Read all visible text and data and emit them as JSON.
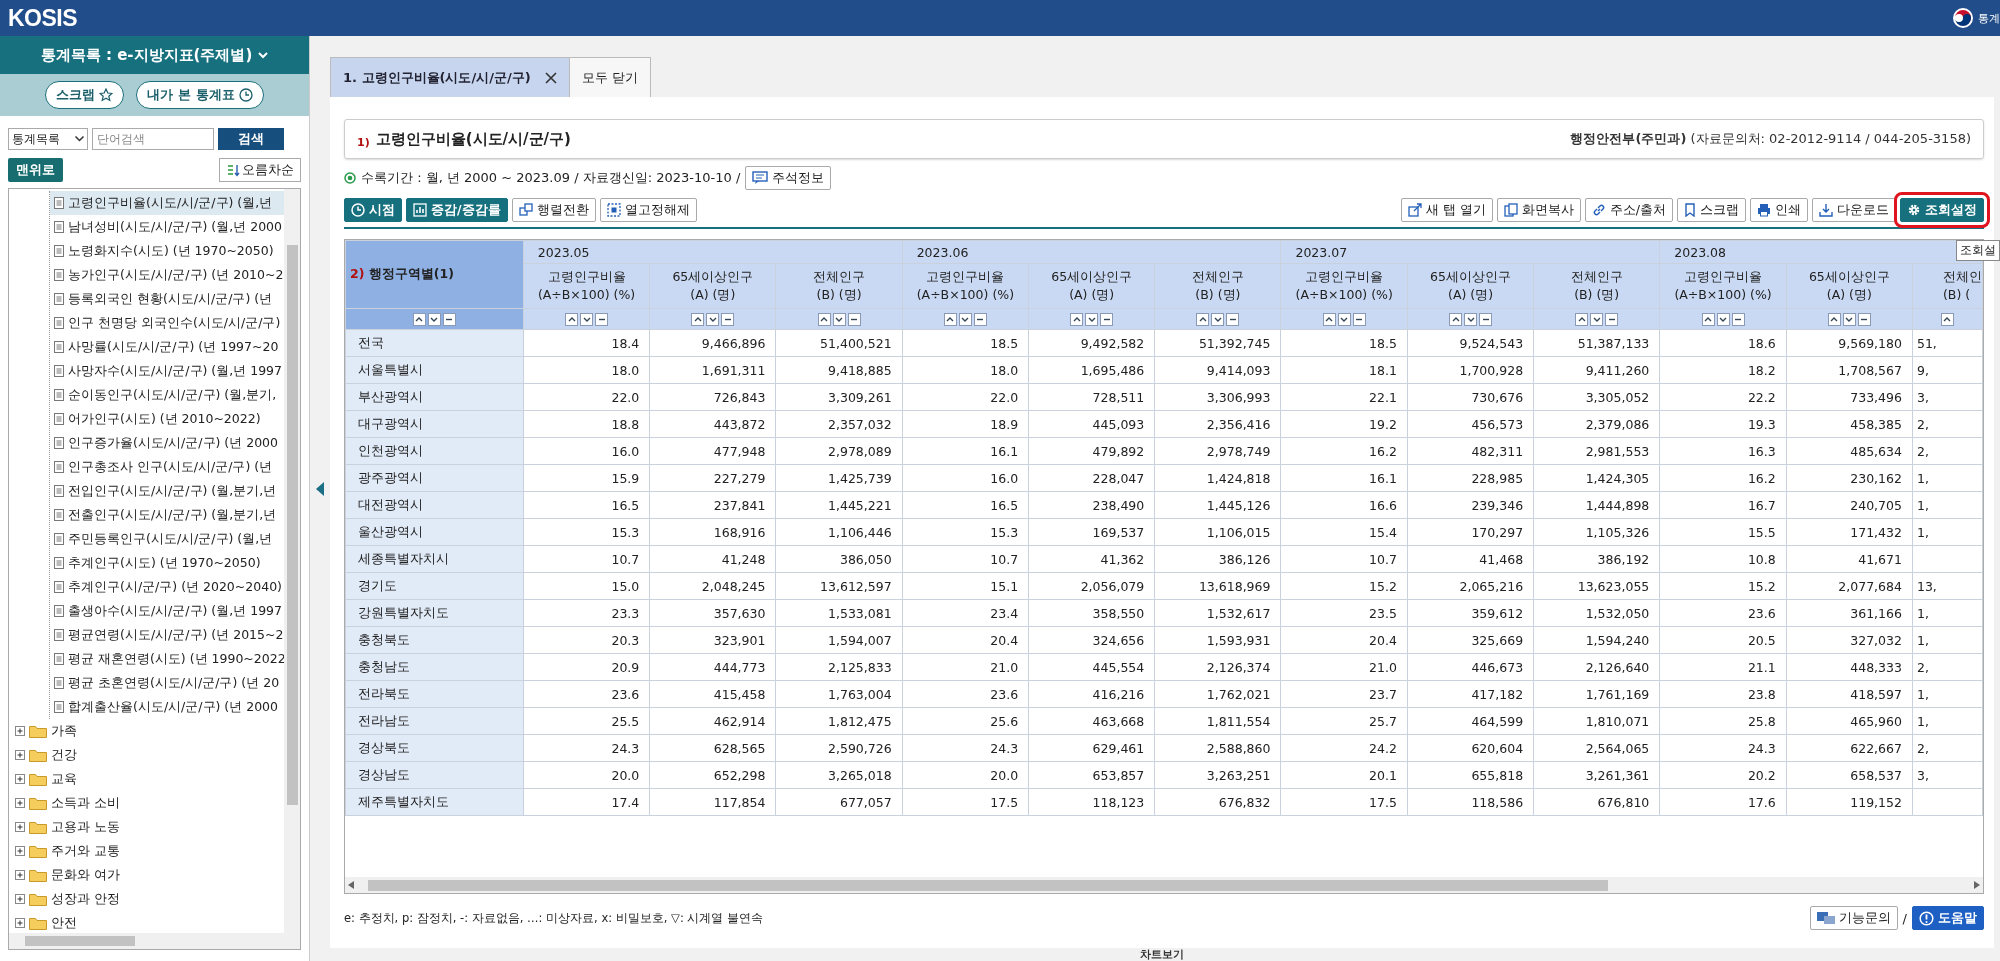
{
  "topbar": {
    "logo": "KOSIS",
    "emblem_text": "통계"
  },
  "sidebar": {
    "title": "통계목록 : e-지방지표(주제별)",
    "buttons": [
      "스크랩",
      "내가 본 통계표"
    ],
    "search": {
      "select": "통계목록",
      "placeholder": "단어검색",
      "button": "검색"
    },
    "top_button": "맨위로",
    "sort_button": "오름차순",
    "tree": [
      {
        "children": [
          {
            "label": "고령인구비율(시도/시/군/구) (월,년",
            "selected": true
          },
          {
            "label": "남녀성비(시도/시/군/구) (월,년 2000",
            "selected": false
          },
          {
            "label": "노령화지수(시도) (년 1970~2050)",
            "selected": false
          },
          {
            "label": "농가인구(시도/시/군/구) (년 2010~2",
            "selected": false
          },
          {
            "label": "등록외국인 현황(시도/시/군/구) (년",
            "selected": false
          },
          {
            "label": "인구 천명당 외국인수(시도/시/군/구)",
            "selected": false
          },
          {
            "label": "사망률(시도/시/군/구) (년 1997~20",
            "selected": false
          },
          {
            "label": "사망자수(시도/시/군/구) (월,년 1997",
            "selected": false
          },
          {
            "label": "순이동인구(시도/시/군/구) (월,분기,",
            "selected": false
          },
          {
            "label": "어가인구(시도) (년 2010~2022)",
            "selected": false
          },
          {
            "label": "인구증가율(시도/시/군/구) (년 2000",
            "selected": false
          },
          {
            "label": "인구총조사 인구(시도/시/군/구) (년",
            "selected": false
          },
          {
            "label": "전입인구(시도/시/군/구) (월,분기,년",
            "selected": false
          },
          {
            "label": "전출인구(시도/시/군/구) (월,분기,년",
            "selected": false
          },
          {
            "label": "주민등록인구(시도/시/군/구) (월,년",
            "selected": false
          },
          {
            "label": "추계인구(시도) (년 1970~2050)",
            "selected": false
          },
          {
            "label": "추계인구(시/군/구) (년 2020~2040)",
            "selected": false
          },
          {
            "label": "출생아수(시도/시/군/구) (월,년 1997",
            "selected": false
          },
          {
            "label": "평균연령(시도/시/군/구) (년 2015~2",
            "selected": false
          },
          {
            "label": "평균 재혼연령(시도) (년 1990~2022",
            "selected": false
          },
          {
            "label": "평균 초혼연령(시도/시/군/구) (년 20",
            "selected": false
          },
          {
            "label": "합계출산율(시도/시/군/구) (년 2000",
            "selected": false
          }
        ]
      },
      {
        "label": "가족",
        "expanded": false
      },
      {
        "label": "건강",
        "expanded": false
      },
      {
        "label": "교육",
        "expanded": false
      },
      {
        "label": "소득과 소비",
        "expanded": false
      },
      {
        "label": "고용과 노동",
        "expanded": false
      },
      {
        "label": "주거와 교통",
        "expanded": false
      },
      {
        "label": "문화와 여가",
        "expanded": false
      },
      {
        "label": "성장과 안정",
        "expanded": false
      },
      {
        "label": "안전",
        "expanded": false
      }
    ]
  },
  "tabs": [
    {
      "label": "1. 고령인구비율(시도/시/군/구)",
      "selected": true
    }
  ],
  "close_all": "모두 닫기",
  "title_box": {
    "note": "1)",
    "title": "고령인구비율(시도/시/군/구)",
    "source": "**행정안전부(주민과)** (자료문의처: 02-2012-9114 / 044-205-3158)"
  },
  "info": {
    "text": "수록기간 : 월, 년 2000 ~ 2023.09 / 자료갱신일: 2023-10-10 /",
    "button": "주석정보"
  },
  "toolbar_left": [
    {
      "label": "시점",
      "kind": "primary"
    },
    {
      "label": "증감/증감률",
      "kind": "primary"
    },
    {
      "label": "행렬전환",
      "kind": "plain"
    },
    {
      "label": "열고정해제",
      "kind": "plain"
    }
  ],
  "toolbar_right": [
    {
      "label": "새 탭 열기",
      "kind": "plain",
      "highlighted": false
    },
    {
      "label": "화면복사",
      "kind": "plain",
      "highlighted": false
    },
    {
      "label": "주소/출처",
      "kind": "plain",
      "highlighted": false
    },
    {
      "label": "스크랩",
      "kind": "plain",
      "highlighted": false
    },
    {
      "label": "인쇄",
      "kind": "plain",
      "highlighted": false
    },
    {
      "label": "다운로드",
      "kind": "plain",
      "highlighted": false
    },
    {
      "label": "조회설정",
      "kind": "primary",
      "highlighted": true
    }
  ],
  "tooltip": "조회설",
  "table": {
    "row_header": {
      "note": "2)",
      "label": "행정구역별(1)"
    },
    "periods": [
      {
        "label": "2023.05",
        "columns": [
          {
            "name": "고령인구비율",
            "unit": "(A÷B×100) (%)"
          },
          {
            "name": "65세이상인구",
            "unit": "(A) (명)"
          },
          {
            "name": "전체인구",
            "unit": "(B) (명)"
          }
        ]
      },
      {
        "label": "2023.06",
        "columns": [
          {
            "name": "고령인구비율",
            "unit": "(A÷B×100) (%)"
          },
          {
            "name": "65세이상인구",
            "unit": "(A) (명)"
          },
          {
            "name": "전체인구",
            "unit": "(B) (명)"
          }
        ]
      },
      {
        "label": "2023.07",
        "columns": [
          {
            "name": "고령인구비율",
            "unit": "(A÷B×100) (%)"
          },
          {
            "name": "65세이상인구",
            "unit": "(A) (명)"
          },
          {
            "name": "전체인구",
            "unit": "(B) (명)"
          }
        ]
      },
      {
        "label": "2023.08",
        "columns": [
          {
            "name": "고령인구비율",
            "unit": "(A÷B×100) (%)"
          },
          {
            "name": "65세이상인구",
            "unit": "(A) (명)"
          },
          {
            "name": "전체인",
            "unit": "(B) (",
            "partial": true
          }
        ]
      }
    ],
    "rows": [
      {
        "region": "전국",
        "values": [
          "18.4",
          "9,466,896",
          "51,400,521",
          "18.5",
          "9,492,582",
          "51,392,745",
          "18.5",
          "9,524,543",
          "51,387,133",
          "18.6",
          "9,569,180",
          "51,"
        ]
      },
      {
        "region": "서울특별시",
        "values": [
          "18.0",
          "1,691,311",
          "9,418,885",
          "18.0",
          "1,695,486",
          "9,414,093",
          "18.1",
          "1,700,928",
          "9,411,260",
          "18.2",
          "1,708,567",
          "9,"
        ]
      },
      {
        "region": "부산광역시",
        "values": [
          "22.0",
          "726,843",
          "3,309,261",
          "22.0",
          "728,511",
          "3,306,993",
          "22.1",
          "730,676",
          "3,305,052",
          "22.2",
          "733,496",
          "3,"
        ]
      },
      {
        "region": "대구광역시",
        "values": [
          "18.8",
          "443,872",
          "2,357,032",
          "18.9",
          "445,093",
          "2,356,416",
          "19.2",
          "456,573",
          "2,379,086",
          "19.3",
          "458,385",
          "2,"
        ]
      },
      {
        "region": "인천광역시",
        "values": [
          "16.0",
          "477,948",
          "2,978,089",
          "16.1",
          "479,892",
          "2,978,749",
          "16.2",
          "482,311",
          "2,981,553",
          "16.3",
          "485,634",
          "2,"
        ]
      },
      {
        "region": "광주광역시",
        "values": [
          "15.9",
          "227,279",
          "1,425,739",
          "16.0",
          "228,047",
          "1,424,818",
          "16.1",
          "228,985",
          "1,424,305",
          "16.2",
          "230,162",
          "1,"
        ]
      },
      {
        "region": "대전광역시",
        "values": [
          "16.5",
          "237,841",
          "1,445,221",
          "16.5",
          "238,490",
          "1,445,126",
          "16.6",
          "239,346",
          "1,444,898",
          "16.7",
          "240,705",
          "1,"
        ]
      },
      {
        "region": "울산광역시",
        "values": [
          "15.3",
          "168,916",
          "1,106,446",
          "15.3",
          "169,537",
          "1,106,015",
          "15.4",
          "170,297",
          "1,105,326",
          "15.5",
          "171,432",
          "1,"
        ]
      },
      {
        "region": "세종특별자치시",
        "values": [
          "10.7",
          "41,248",
          "386,050",
          "10.7",
          "41,362",
          "386,126",
          "10.7",
          "41,468",
          "386,192",
          "10.8",
          "41,671"
        ]
      },
      {
        "region": "경기도",
        "values": [
          "15.0",
          "2,048,245",
          "13,612,597",
          "15.1",
          "2,056,079",
          "13,618,969",
          "15.2",
          "2,065,216",
          "13,623,055",
          "15.2",
          "2,077,684",
          "13,"
        ]
      },
      {
        "region": "강원특별자치도",
        "values": [
          "23.3",
          "357,630",
          "1,533,081",
          "23.4",
          "358,550",
          "1,532,617",
          "23.5",
          "359,612",
          "1,532,050",
          "23.6",
          "361,166",
          "1,"
        ]
      },
      {
        "region": "충청북도",
        "values": [
          "20.3",
          "323,901",
          "1,594,007",
          "20.4",
          "324,656",
          "1,593,931",
          "20.4",
          "325,669",
          "1,594,240",
          "20.5",
          "327,032",
          "1,"
        ]
      },
      {
        "region": "충청남도",
        "values": [
          "20.9",
          "444,773",
          "2,125,833",
          "21.0",
          "445,554",
          "2,126,374",
          "21.0",
          "446,673",
          "2,126,640",
          "21.1",
          "448,333",
          "2,"
        ]
      },
      {
        "region": "전라북도",
        "values": [
          "23.6",
          "415,458",
          "1,763,004",
          "23.6",
          "416,216",
          "1,762,021",
          "23.7",
          "417,182",
          "1,761,169",
          "23.8",
          "418,597",
          "1,"
        ]
      },
      {
        "region": "전라남도",
        "values": [
          "25.5",
          "462,914",
          "1,812,475",
          "25.6",
          "463,668",
          "1,811,554",
          "25.7",
          "464,599",
          "1,810,071",
          "25.8",
          "465,960",
          "1,"
        ]
      },
      {
        "region": "경상북도",
        "values": [
          "24.3",
          "628,565",
          "2,590,726",
          "24.3",
          "629,461",
          "2,588,860",
          "24.2",
          "620,604",
          "2,564,065",
          "24.3",
          "622,667",
          "2,"
        ]
      },
      {
        "region": "경상남도",
        "values": [
          "20.0",
          "652,298",
          "3,265,018",
          "20.0",
          "653,857",
          "3,263,251",
          "20.1",
          "655,818",
          "3,261,361",
          "20.2",
          "658,537",
          "3,"
        ]
      },
      {
        "region": "제주특별자치도",
        "values": [
          "17.4",
          "117,854",
          "677,057",
          "17.5",
          "118,123",
          "676,832",
          "17.5",
          "118,586",
          "676,810",
          "17.6",
          "119,152"
        ]
      }
    ]
  },
  "legend": "e: 추정치, p: 잠정치, -: 자료없음, …: 미상자료, x: 비밀보호, ▽: 시계열 불연속",
  "footer_buttons": [
    "기능문의",
    "/",
    "도움말"
  ],
  "chart_toggle": "차트보기"
}
